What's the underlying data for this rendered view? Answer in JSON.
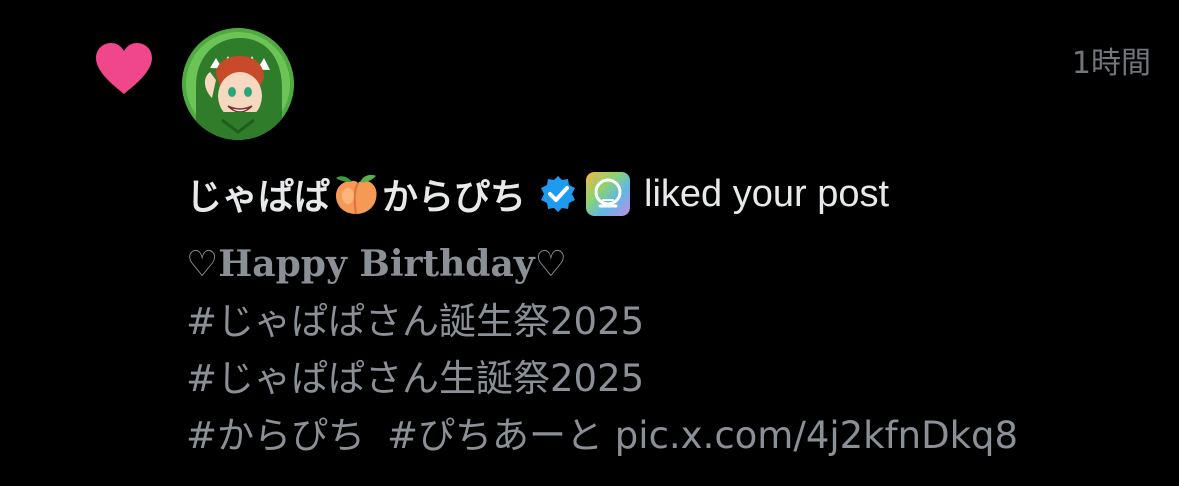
{
  "notification": {
    "timestamp": "1時間",
    "user": {
      "display_name_part1": "じゃぱぱ",
      "display_name_emoji": "peach-icon",
      "display_name_part2": "からぴち",
      "verified_icon": "verified-icon",
      "affiliate_badge_icon": "badge-icon"
    },
    "action_text": "liked your post",
    "post": {
      "line1": "♡Happy Birthday♡",
      "hashtag1": "#じゃぱぱさん誕生祭2025",
      "hashtag2": "#じゃぱぱさん生誕祭2025",
      "hashtag3": "#からぴち",
      "hashtag4": "#ぴちあーと",
      "link": "pic.x.com/4j2kfnDkq8"
    }
  },
  "colors": {
    "background": "#000000",
    "heart": "#f0468c",
    "primary_text": "#e7e9ea",
    "secondary_text": "#8b9096",
    "verified": "#1d9bf0"
  }
}
